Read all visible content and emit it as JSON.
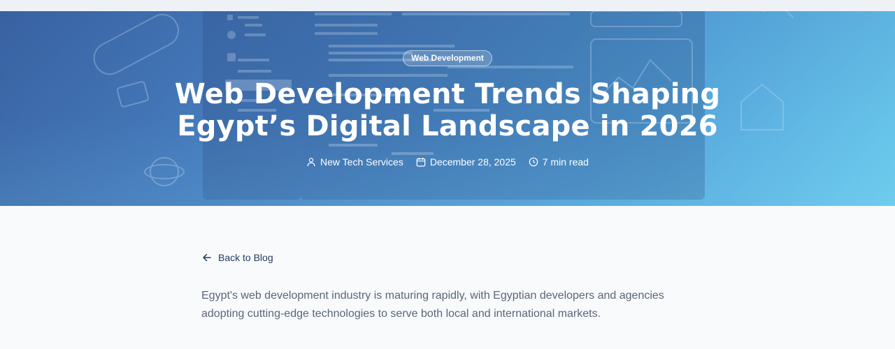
{
  "hero": {
    "category": "Web Development",
    "title": "Web Development Trends Shaping Egypt’s Digital Landscape in 2026",
    "meta": {
      "author": "New Tech Services",
      "date": "December 28, 2025",
      "read_time": "7 min read"
    },
    "background_colors": [
      "#3a63a3",
      "#56a6dc",
      "#6ccdee"
    ]
  },
  "content": {
    "back_label": "Back to Blog",
    "intro": "Egypt's web development industry is maturing rapidly, with Egyptian developers and agencies adopting cutting-edge technologies to serve both local and international markets."
  },
  "icons": {
    "author": "user-icon",
    "date": "calendar-icon",
    "read_time": "clock-icon",
    "back": "arrow-left-icon"
  }
}
